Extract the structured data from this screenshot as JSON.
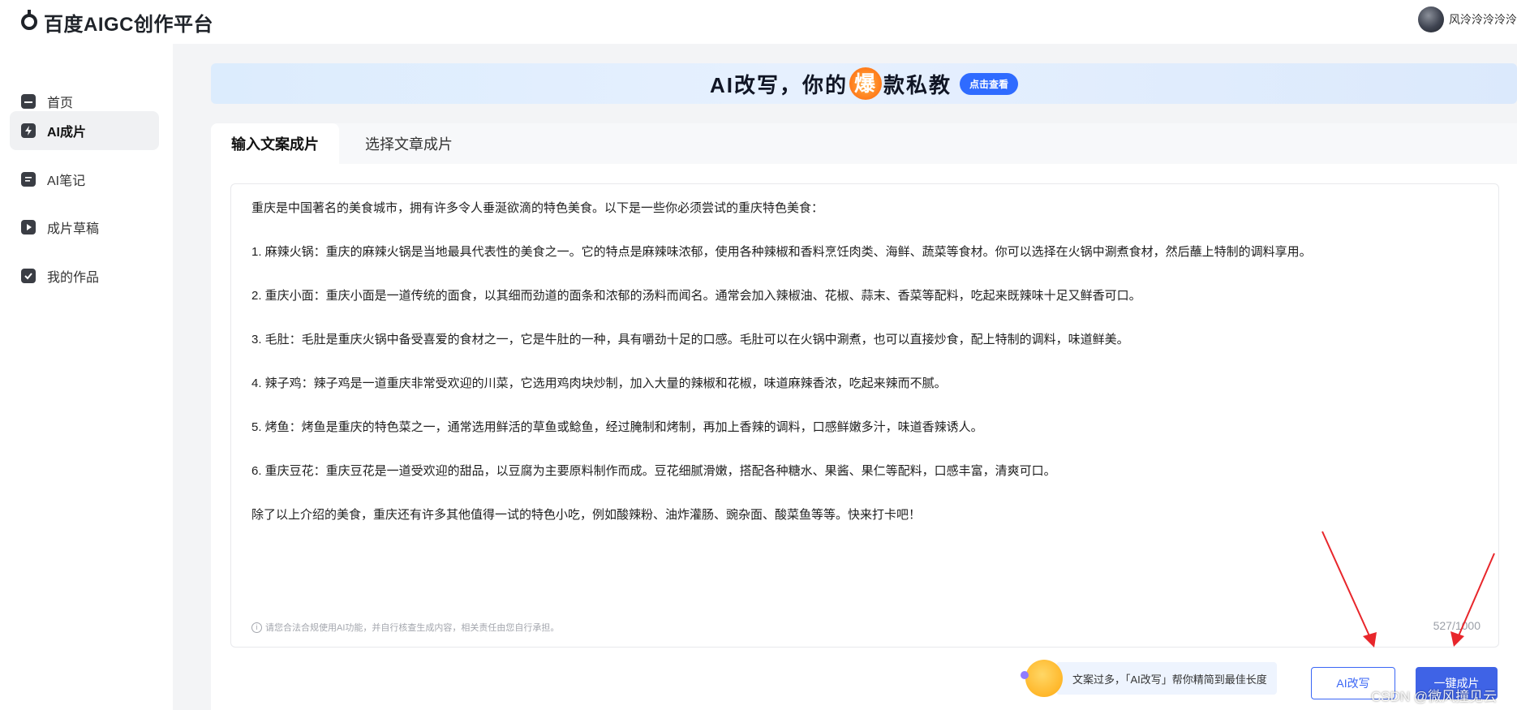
{
  "header": {
    "logo_text": "百度AIGC创作平台",
    "username": "风泠泠泠泠泠"
  },
  "sidebar": {
    "items": [
      {
        "label": "首页",
        "icon": "home-icon",
        "active": false
      },
      {
        "label": "AI成片",
        "icon": "lightning-icon",
        "active": true
      },
      {
        "label": "AI笔记",
        "icon": "note-icon",
        "active": false
      },
      {
        "label": "成片草稿",
        "icon": "play-icon",
        "active": false
      },
      {
        "label": "我的作品",
        "icon": "check-icon",
        "active": false
      }
    ]
  },
  "banner": {
    "title_pre": "AI改写，你的",
    "title_highlight": "爆",
    "title_post": "款私教",
    "button_label": "点击查看"
  },
  "tabs": [
    {
      "label": "输入文案成片",
      "active": true
    },
    {
      "label": "选择文章成片",
      "active": false
    }
  ],
  "editor": {
    "paragraphs": [
      "重庆是中国著名的美食城市，拥有许多令人垂涎欲滴的特色美食。以下是一些你必须尝试的重庆特色美食：",
      "1. 麻辣火锅：重庆的麻辣火锅是当地最具代表性的美食之一。它的特点是麻辣味浓郁，使用各种辣椒和香料烹饪肉类、海鲜、蔬菜等食材。你可以选择在火锅中涮煮食材，然后蘸上特制的调料享用。",
      "2. 重庆小面：重庆小面是一道传统的面食，以其细而劲道的面条和浓郁的汤料而闻名。通常会加入辣椒油、花椒、蒜末、香菜等配料，吃起来既辣味十足又鲜香可口。",
      "3. 毛肚：毛肚是重庆火锅中备受喜爱的食材之一，它是牛肚的一种，具有嚼劲十足的口感。毛肚可以在火锅中涮煮，也可以直接炒食，配上特制的调料，味道鲜美。",
      "4. 辣子鸡：辣子鸡是一道重庆非常受欢迎的川菜，它选用鸡肉块炒制，加入大量的辣椒和花椒，味道麻辣香浓，吃起来辣而不腻。",
      "5. 烤鱼：烤鱼是重庆的特色菜之一，通常选用鲜活的草鱼或鲶鱼，经过腌制和烤制，再加上香辣的调料，口感鲜嫩多汁，味道香辣诱人。",
      "6. 重庆豆花：重庆豆花是一道受欢迎的甜品，以豆腐为主要原料制作而成。豆花细腻滑嫩，搭配各种糖水、果酱、果仁等配料，口感丰富，清爽可口。",
      "除了以上介绍的美食，重庆还有许多其他值得一试的特色小吃，例如酸辣粉、油炸灌肠、豌杂面、酸菜鱼等等。快来打卡吧！"
    ],
    "notice": "请您合法合规使用AI功能，并自行核查生成内容，相关责任由您自行承担。",
    "counter": "527/1000"
  },
  "actions": {
    "tip_text": "文案过多，「AI改写」帮你精简到最佳长度",
    "rewrite_label": "AI改写",
    "generate_label": "一键成片"
  },
  "watermark": "CSDN @微风撞见云",
  "colors": {
    "primary": "#3f63e6",
    "annotation_arrow": "#e8262b"
  }
}
